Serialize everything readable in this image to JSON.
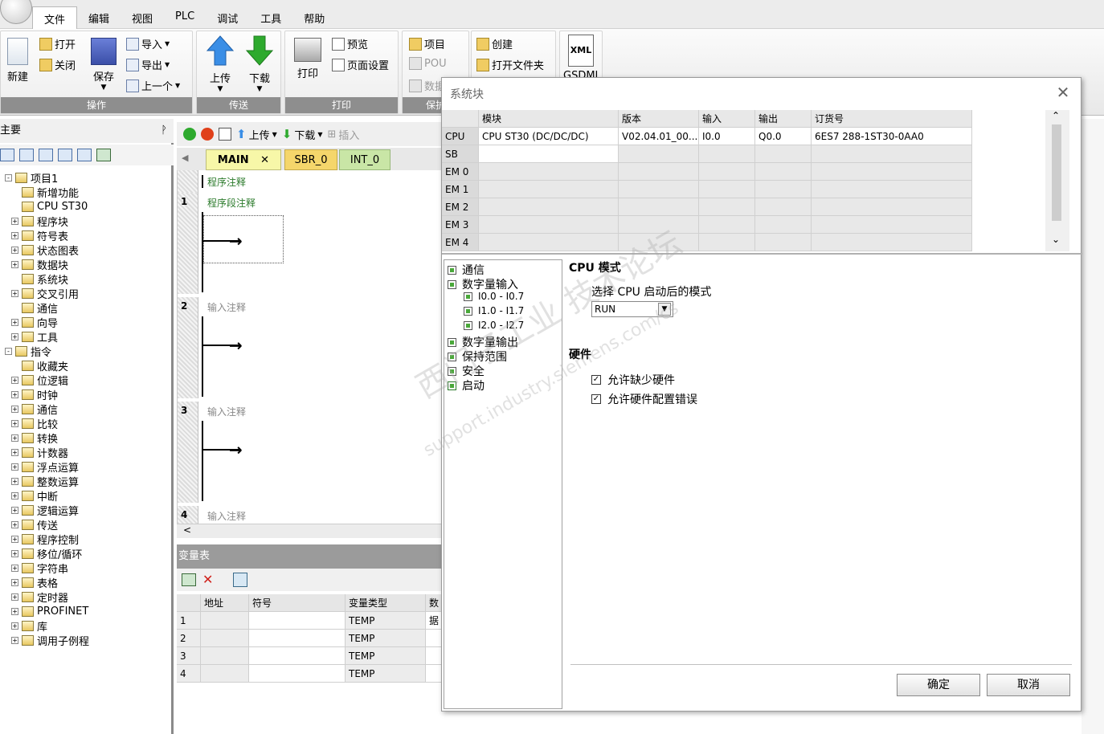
{
  "menu": {
    "items": [
      "文件",
      "编辑",
      "视图",
      "PLC",
      "调试",
      "工具",
      "帮助"
    ],
    "active_index": 0
  },
  "ribbon": {
    "new": "新建",
    "open": "打开",
    "close": "关闭",
    "save": "保存",
    "import": "导入",
    "export": "导出",
    "previous": "上一个",
    "group_operations": "操作",
    "upload": "上传",
    "download": "下载",
    "group_transfer": "传送",
    "print": "打印",
    "preview": "预览",
    "page_setup": "页面设置",
    "group_print": "打印",
    "project": "项目",
    "pou": "POU",
    "data": "数据",
    "group_protect": "保护",
    "create": "创建",
    "open_folder": "打开文件夹",
    "xml": "XML",
    "gsdml": "GSDML"
  },
  "left_panel": {
    "title": "主要",
    "pin": "ㅁ",
    "tree": [
      {
        "label": "项目1",
        "level": 0,
        "expand": "-"
      },
      {
        "label": "新增功能",
        "level": 1,
        "expand": ""
      },
      {
        "label": "CPU ST30",
        "level": 1,
        "expand": ""
      },
      {
        "label": "程序块",
        "level": 1,
        "expand": "+"
      },
      {
        "label": "符号表",
        "level": 1,
        "expand": "+"
      },
      {
        "label": "状态图表",
        "level": 1,
        "expand": "+"
      },
      {
        "label": "数据块",
        "level": 1,
        "expand": "+"
      },
      {
        "label": "系统块",
        "level": 1,
        "expand": ""
      },
      {
        "label": "交叉引用",
        "level": 1,
        "expand": "+"
      },
      {
        "label": "通信",
        "level": 1,
        "expand": ""
      },
      {
        "label": "向导",
        "level": 1,
        "expand": "+"
      },
      {
        "label": "工具",
        "level": 1,
        "expand": "+"
      },
      {
        "label": "指令",
        "level": 0,
        "expand": "-"
      },
      {
        "label": "收藏夹",
        "level": 1,
        "expand": ""
      },
      {
        "label": "位逻辑",
        "level": 1,
        "expand": "+"
      },
      {
        "label": "时钟",
        "level": 1,
        "expand": "+"
      },
      {
        "label": "通信",
        "level": 1,
        "expand": "+"
      },
      {
        "label": "比较",
        "level": 1,
        "expand": "+"
      },
      {
        "label": "转换",
        "level": 1,
        "expand": "+"
      },
      {
        "label": "计数器",
        "level": 1,
        "expand": "+"
      },
      {
        "label": "浮点运算",
        "level": 1,
        "expand": "+"
      },
      {
        "label": "整数运算",
        "level": 1,
        "expand": "+"
      },
      {
        "label": "中断",
        "level": 1,
        "expand": "+"
      },
      {
        "label": "逻辑运算",
        "level": 1,
        "expand": "+"
      },
      {
        "label": "传送",
        "level": 1,
        "expand": "+"
      },
      {
        "label": "程序控制",
        "level": 1,
        "expand": "+"
      },
      {
        "label": "移位/循环",
        "level": 1,
        "expand": "+"
      },
      {
        "label": "字符串",
        "level": 1,
        "expand": "+"
      },
      {
        "label": "表格",
        "level": 1,
        "expand": "+"
      },
      {
        "label": "定时器",
        "level": 1,
        "expand": "+"
      },
      {
        "label": "PROFINET",
        "level": 1,
        "expand": "+"
      },
      {
        "label": "库",
        "level": 1,
        "expand": "+"
      },
      {
        "label": "调用子例程",
        "level": 1,
        "expand": "+"
      }
    ]
  },
  "editor": {
    "toolbar": {
      "upload": "上传",
      "download": "下载",
      "insert": "插入"
    },
    "tabs": [
      "MAIN",
      "SBR_0",
      "INT_0"
    ],
    "program_comment": "程序注释",
    "rungs": [
      {
        "number": "1",
        "comment": "程序段注释"
      },
      {
        "number": "2",
        "comment": "输入注释"
      },
      {
        "number": "3",
        "comment": "输入注释"
      },
      {
        "number": "4",
        "comment": "输入注释"
      }
    ],
    "scroll_left": "<"
  },
  "var_table": {
    "title": "变量表",
    "headers": [
      "",
      "地址",
      "符号",
      "变量类型",
      "数据"
    ],
    "rows": [
      {
        "num": "1",
        "type": "TEMP"
      },
      {
        "num": "2",
        "type": "TEMP"
      },
      {
        "num": "3",
        "type": "TEMP"
      },
      {
        "num": "4",
        "type": "TEMP"
      }
    ]
  },
  "dialog": {
    "title": "系统块",
    "close": "✕",
    "module_headers": [
      "",
      "模块",
      "版本",
      "输入",
      "输出",
      "订货号"
    ],
    "module_rows": [
      {
        "slot": "CPU",
        "module": "CPU ST30 (DC/DC/DC)",
        "version": "V02.04.01_00....",
        "input": "I0.0",
        "output": "Q0.0",
        "order": "6ES7 288-1ST30-0AA0"
      },
      {
        "slot": "SB",
        "module": "",
        "version": "",
        "input": "",
        "output": "",
        "order": ""
      },
      {
        "slot": "EM 0",
        "module": "",
        "version": "",
        "input": "",
        "output": "",
        "order": ""
      },
      {
        "slot": "EM 1",
        "module": "",
        "version": "",
        "input": "",
        "output": "",
        "order": ""
      },
      {
        "slot": "EM 2",
        "module": "",
        "version": "",
        "input": "",
        "output": "",
        "order": ""
      },
      {
        "slot": "EM 3",
        "module": "",
        "version": "",
        "input": "",
        "output": "",
        "order": ""
      },
      {
        "slot": "EM 4",
        "module": "",
        "version": "",
        "input": "",
        "output": "",
        "order": ""
      }
    ],
    "categories": [
      {
        "label": "通信",
        "indent": 0,
        "checked": false
      },
      {
        "label": "数字量输入",
        "indent": 0,
        "checked": false
      },
      {
        "label": "I0.0 - I0.7",
        "indent": 1,
        "checked": false
      },
      {
        "label": "I1.0 - I1.7",
        "indent": 1,
        "checked": false
      },
      {
        "label": "I2.0 - I2.7",
        "indent": 1,
        "checked": false
      },
      {
        "label": "数字量输出",
        "indent": 0,
        "checked": false
      },
      {
        "label": "保持范围",
        "indent": 0,
        "checked": false
      },
      {
        "label": "安全",
        "indent": 0,
        "checked": false
      },
      {
        "label": "启动",
        "indent": 0,
        "checked": true
      }
    ],
    "cpu_mode_heading": "CPU 模式",
    "cpu_mode_label": "选择 CPU 启动后的模式",
    "cpu_mode_value": "RUN",
    "hardware_heading": "硬件",
    "allow_missing_hw": "允许缺少硬件",
    "allow_hw_config_error": "允许硬件配置错误",
    "ok": "确定",
    "cancel": "取消",
    "watermark_cn": "西门子工业 技术论坛",
    "watermark_en": "support.industry.siemens.com/cs"
  },
  "colors": {
    "ribbon_label_bg": "#8e8e8e",
    "tab_main": "#f7f7a8",
    "tab_sbr": "#f5d66b",
    "tab_int": "#c9e6a6",
    "comment_green": "#2a7a2a",
    "upload_arrow": "#3a8ee6",
    "download_arrow": "#2eaa2e"
  }
}
